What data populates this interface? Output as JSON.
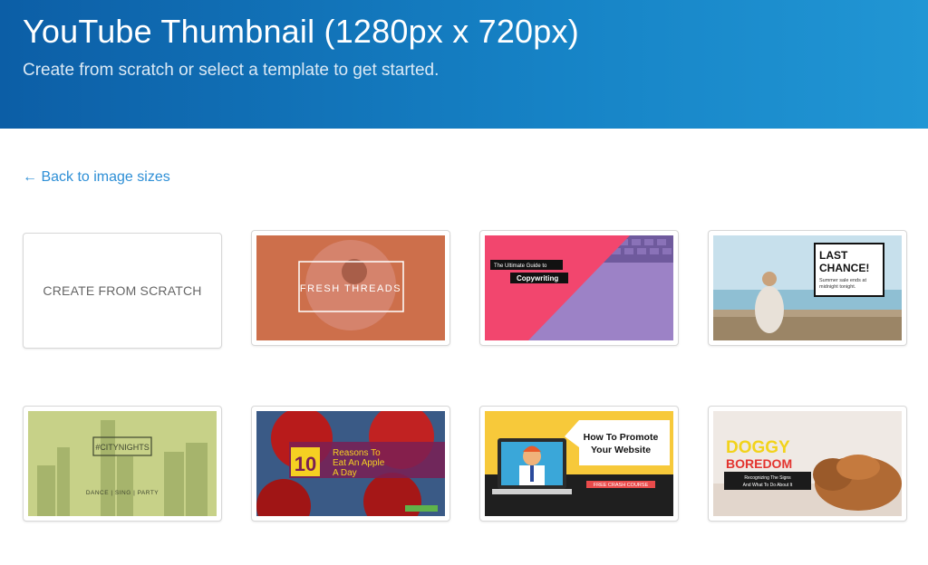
{
  "header": {
    "title": "YouTube Thumbnail (1280px x 720px)",
    "subtitle": "Create from scratch or select a template to get started."
  },
  "nav": {
    "back_label": "← Back to image sizes"
  },
  "scratch": {
    "label": "CREATE FROM SCRATCH"
  },
  "templates": [
    {
      "id": "fresh-threads",
      "text": [
        "FRESH THREADS"
      ]
    },
    {
      "id": "copywriting",
      "text": [
        "The Ultimate Guide to",
        "Copywriting"
      ]
    },
    {
      "id": "last-chance",
      "text": [
        "LAST",
        "CHANCE!",
        "Summer sale ends at",
        "midnight tonight."
      ]
    },
    {
      "id": "city-nights",
      "text": [
        "#CITYNIGHTS",
        "DANCE | SING | PARTY"
      ]
    },
    {
      "id": "apple",
      "text": [
        "10",
        "Reasons To",
        "Eat An Apple",
        "A Day"
      ]
    },
    {
      "id": "promote-website",
      "text": [
        "How To Promote",
        "Your Website",
        "FREE CRASH COURSE"
      ]
    },
    {
      "id": "doggy-boredom",
      "text": [
        "DOGGY",
        "BOREDOM",
        "Recognizing The Signs",
        "And What To Do About It"
      ]
    }
  ],
  "colors": {
    "header_start": "#0c5ea6",
    "header_end": "#2196d4",
    "link": "#2e8fd6"
  }
}
